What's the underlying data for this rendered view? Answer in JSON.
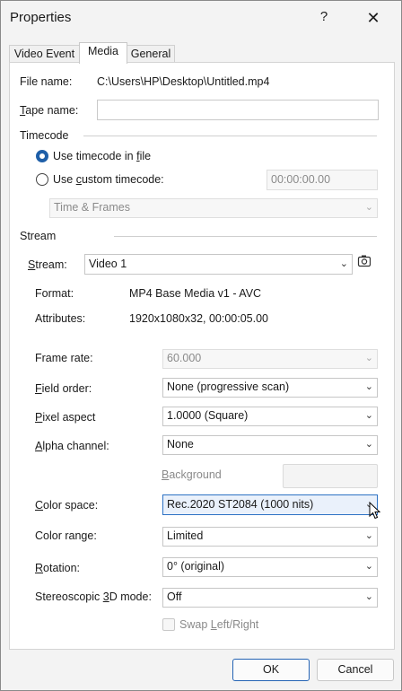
{
  "window": {
    "title": "Properties",
    "help": "?",
    "close": "✕"
  },
  "tabs": [
    {
      "label": "Video Event"
    },
    {
      "label": "Media"
    },
    {
      "label": "General"
    }
  ],
  "file": {
    "name_label": "File name:",
    "name_value": "C:\\Users\\HP\\Desktop\\Untitled.mp4",
    "tape_label_u": "T",
    "tape_label_rest": "ape name:",
    "tape_value": ""
  },
  "timecode": {
    "section": "Timecode",
    "use_file_pre": "Use timecode in ",
    "use_file_u": "f",
    "use_file_post": "ile",
    "use_custom_pre": "Use ",
    "use_custom_u": "c",
    "use_custom_post": "ustom timecode:",
    "custom_value": "00:00:00.00",
    "format": "Time & Frames",
    "selected": "use_file"
  },
  "stream": {
    "section": "Stream",
    "label_u": "S",
    "label_rest": "tream:",
    "value": "Video 1",
    "format_label": "Format:",
    "format_value": "MP4 Base Media v1 - AVC",
    "attributes_label": "Attributes:",
    "attributes_value": "1920x1080x32, 00:00:05.00"
  },
  "props": {
    "frame_rate_label": "Frame rate:",
    "frame_rate_value": "60.000",
    "field_order_u": "F",
    "field_order_rest": "ield order:",
    "field_order_value": "None (progressive scan)",
    "pixel_aspect_u": "P",
    "pixel_aspect_rest": "ixel aspect",
    "pixel_aspect_value": "1.0000 (Square)",
    "alpha_u": "A",
    "alpha_rest": "lpha channel:",
    "alpha_value": "None",
    "background_u": "B",
    "background_rest": "ackground",
    "color_space_u": "C",
    "color_space_rest": "olor space:",
    "color_space_value": "Rec.2020 ST2084 (1000 nits)",
    "color_range_label": "Color range:",
    "color_range_value": "Limited",
    "rotation_u": "R",
    "rotation_rest": "otation:",
    "rotation_value": "0° (original)",
    "stereo_pre": "Stereoscopic ",
    "stereo_u": "3",
    "stereo_post": "D mode:",
    "stereo_value": "Off",
    "swap_pre": "Swap ",
    "swap_u": "L",
    "swap_post": "eft/Right"
  },
  "buttons": {
    "ok": "OK",
    "cancel": "Cancel"
  },
  "colors": {
    "accent": "#1f5fa8",
    "focus_border": "#2d72c4"
  }
}
